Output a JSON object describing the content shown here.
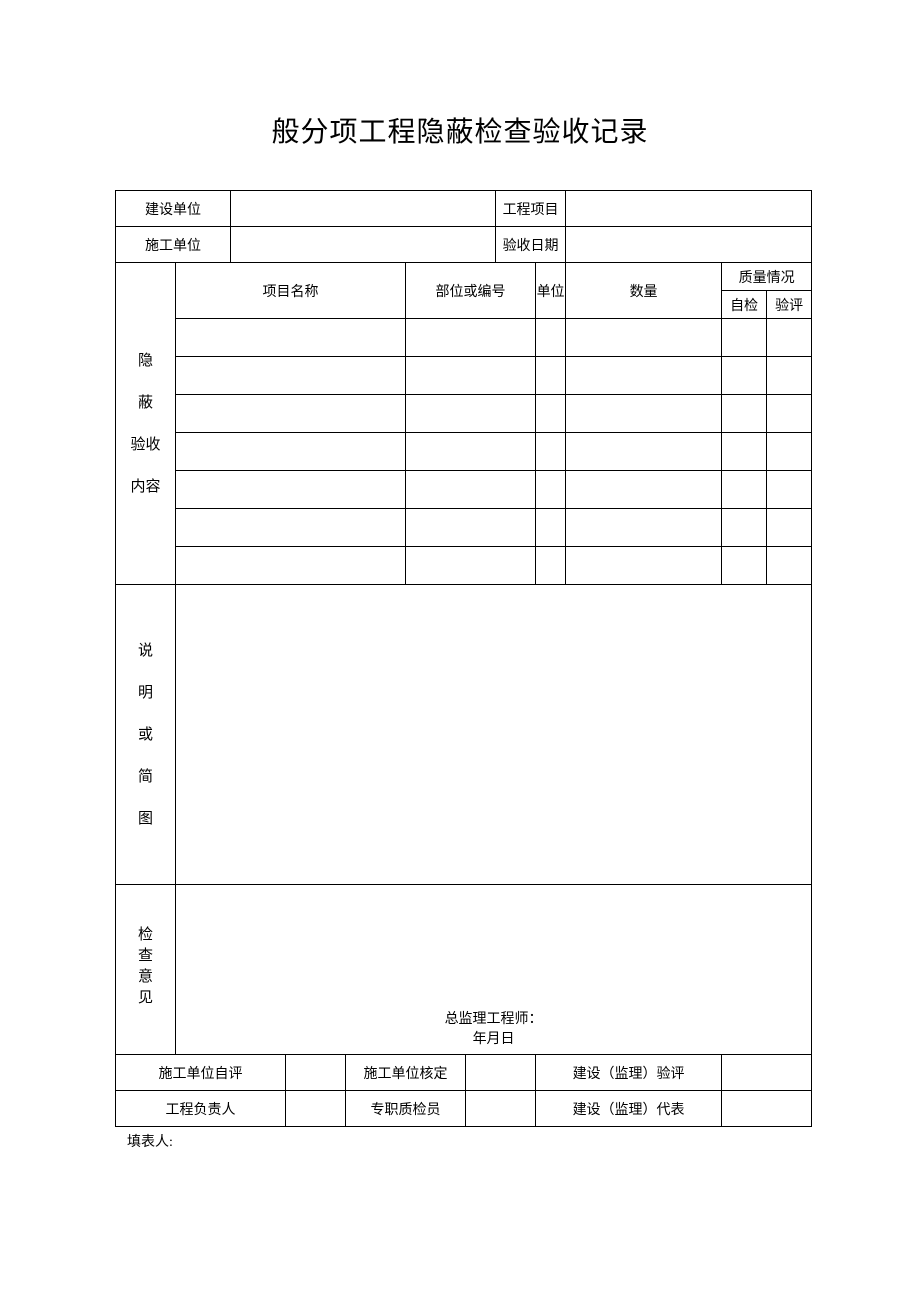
{
  "title": "般分项工程隐蔽检查验收记录",
  "header": {
    "constructionUnitLabel": "建设单位",
    "constructionUnitValue": "",
    "projectLabel": "工程项目",
    "projectValue": "",
    "contractorLabel": "施工单位",
    "contractorValue": "",
    "acceptDateLabel": "验收日期",
    "acceptDateValue": ""
  },
  "section1": {
    "sideLabel": "隐\n蔽\n验收\n内容",
    "cols": {
      "itemName": "项目名称",
      "partOrNo": "部位或编号",
      "unit": "单位",
      "quantity": "数量",
      "quality": "质量情况",
      "selfCheck": "自检",
      "review": "验评"
    },
    "rows": [
      {
        "itemName": "",
        "partOrNo": "",
        "unit": "",
        "quantity": "",
        "selfCheck": "",
        "review": ""
      },
      {
        "itemName": "",
        "partOrNo": "",
        "unit": "",
        "quantity": "",
        "selfCheck": "",
        "review": ""
      },
      {
        "itemName": "",
        "partOrNo": "",
        "unit": "",
        "quantity": "",
        "selfCheck": "",
        "review": ""
      },
      {
        "itemName": "",
        "partOrNo": "",
        "unit": "",
        "quantity": "",
        "selfCheck": "",
        "review": ""
      },
      {
        "itemName": "",
        "partOrNo": "",
        "unit": "",
        "quantity": "",
        "selfCheck": "",
        "review": ""
      },
      {
        "itemName": "",
        "partOrNo": "",
        "unit": "",
        "quantity": "",
        "selfCheck": "",
        "review": ""
      },
      {
        "itemName": "",
        "partOrNo": "",
        "unit": "",
        "quantity": "",
        "selfCheck": "",
        "review": ""
      }
    ]
  },
  "section2": {
    "sideLabel": "说\n明\n或\n简\n图",
    "content": ""
  },
  "section3": {
    "sideLabel": "检\n查\n意\n见",
    "chiefEngineerLabel": "总监理工程师：",
    "dateLabel": "年月日"
  },
  "footerRows": {
    "r1c1": "施工单位自评",
    "r1c1v": "",
    "r1c2": "施工单位核定",
    "r1c2v": "",
    "r1c3": "建设（监理）验评",
    "r1c3v": "",
    "r2c1": "工程负责人",
    "r2c1v": "",
    "r2c2": "专职质检员",
    "r2c2v": "",
    "r2c3": "建设（监理）代表",
    "r2c3v": ""
  },
  "footerNote": "填表人:"
}
